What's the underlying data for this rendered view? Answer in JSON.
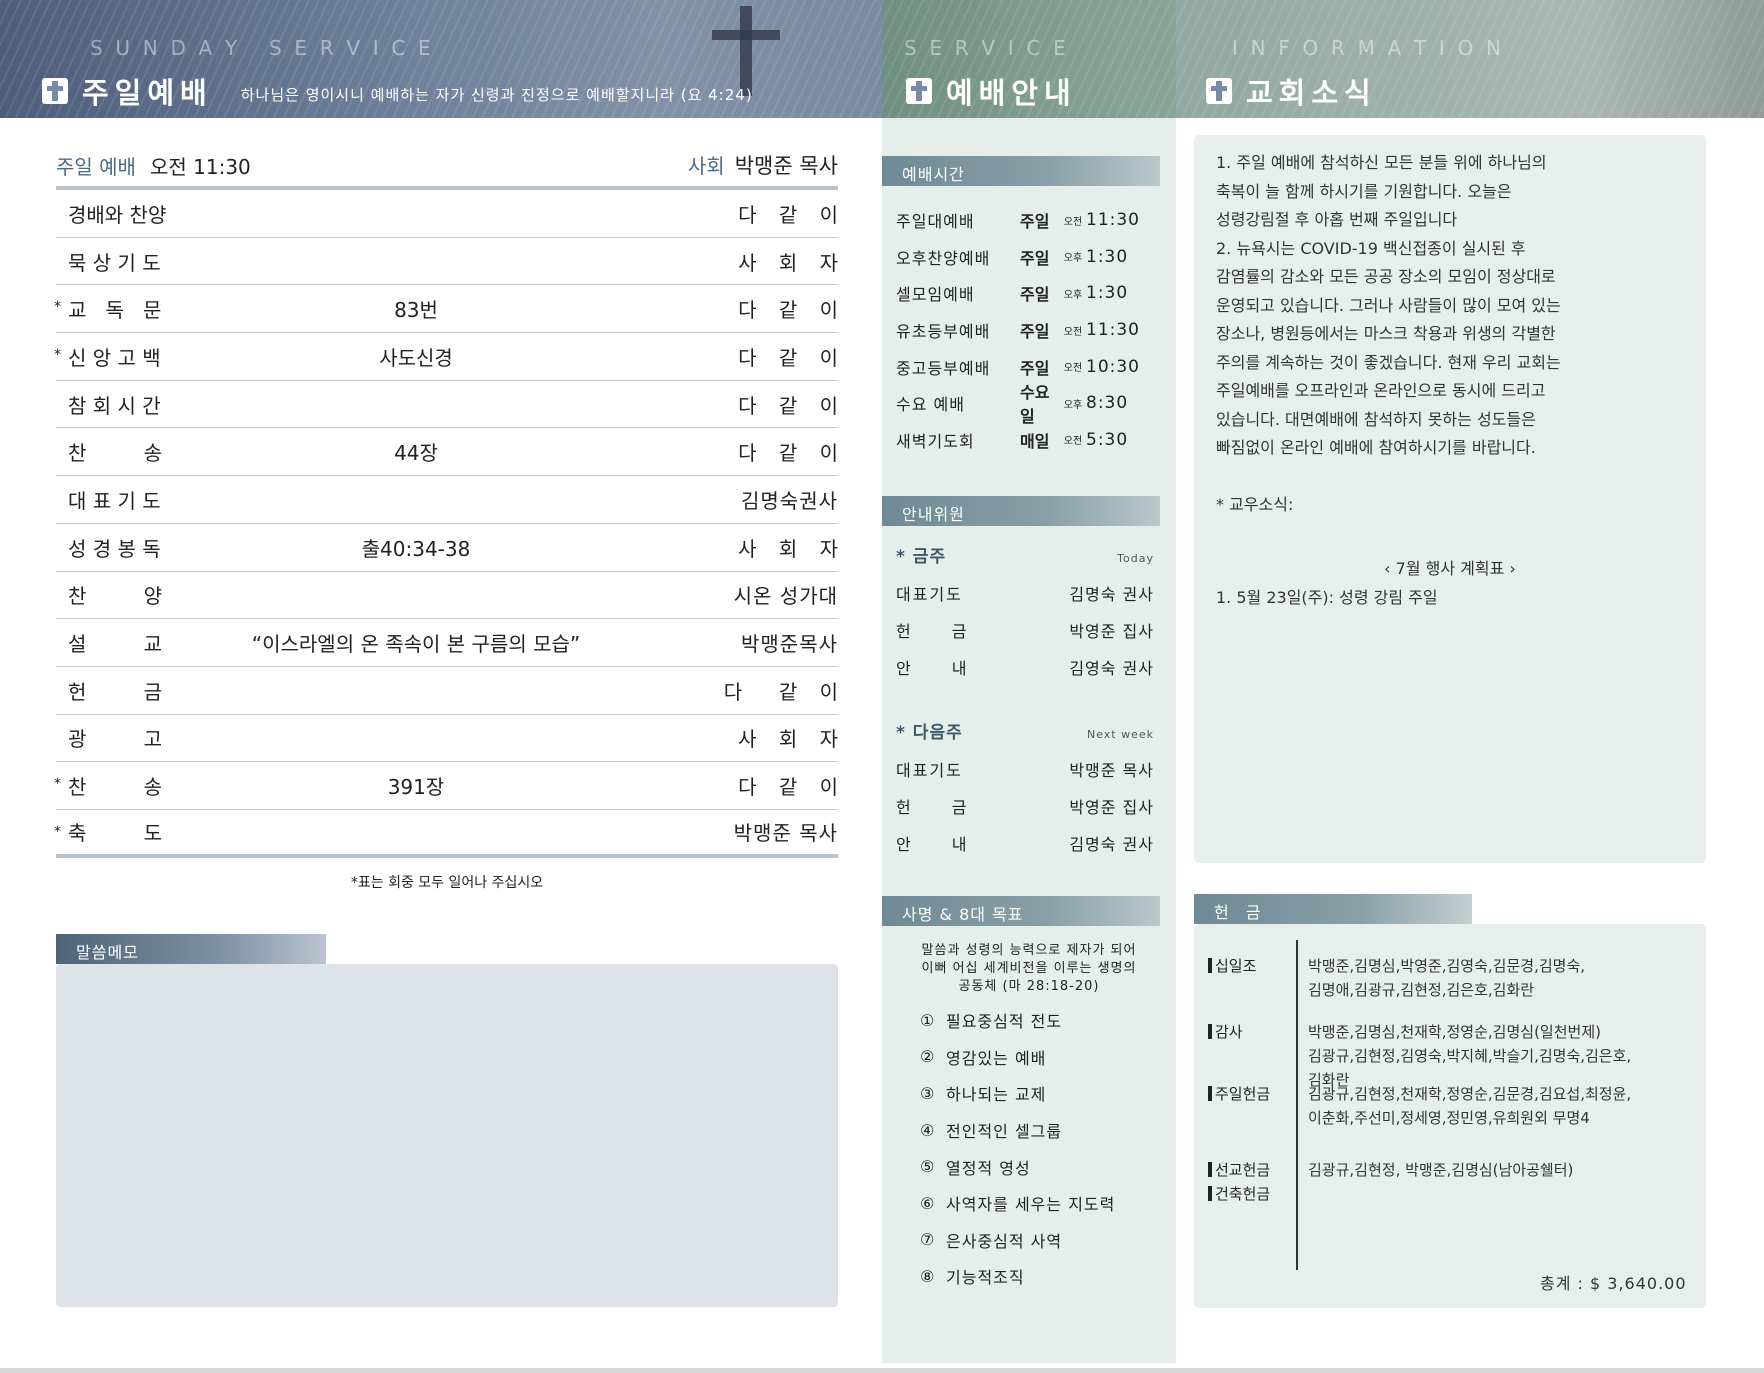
{
  "header": {
    "left": {
      "spaced": "S  U  N  D  A  Y     S  E  R  V  I  C  E",
      "title": "주일예배",
      "verse": "하나님은 영이시니 예배하는 자가 신령과 진정으로 예배할지니라 (요 4:24)"
    },
    "middle": {
      "spaced": "S  E  R  V  I  C  E",
      "title": "예배안내"
    },
    "right": {
      "spaced": "I  N  F  O  R  M  A  T  I  O  N",
      "title": "교회소식"
    },
    "icon": "cross-icon"
  },
  "service": {
    "label": "주일 예배",
    "time": "오전 11:30",
    "leader_label": "사회",
    "leader": "박맹준 목사",
    "order": [
      {
        "star": "",
        "item": "경배와 찬양",
        "center": "",
        "right": "다 같 이"
      },
      {
        "star": "",
        "item": "묵 상 기 도",
        "center": "",
        "right": "사 회 자"
      },
      {
        "star": "*",
        "item": "교   독   문",
        "center": "83번",
        "right": "다 같 이"
      },
      {
        "star": "*",
        "item": "신 앙 고 백",
        "center": "사도신경",
        "right": "다 같 이"
      },
      {
        "star": "",
        "item": "참 회 시 간",
        "center": "",
        "right": "다 같 이"
      },
      {
        "star": "",
        "item": "찬         송",
        "center": "44장",
        "right": "다 같 이"
      },
      {
        "star": "",
        "item": "대 표 기 도",
        "center": "",
        "right": "김명숙권사"
      },
      {
        "star": "",
        "item": "성 경 봉 독",
        "center": "출40:34-38",
        "right": "사 회 자"
      },
      {
        "star": "",
        "item": "찬         양",
        "center": "",
        "right": "시온 성가대"
      },
      {
        "star": "",
        "item": "설         교",
        "center": "“이스라엘의 온 족속이 본 구름의 모습”",
        "right": "박맹준목사"
      },
      {
        "star": "",
        "item": "헌         금",
        "center": "",
        "right": "다  같 이"
      },
      {
        "star": "",
        "item": "광         고",
        "center": "",
        "right": "사 회 자"
      },
      {
        "star": "*",
        "item": "찬         송",
        "center": "391장",
        "right": "다 같 이"
      },
      {
        "star": "*",
        "item": "축         도",
        "center": "",
        "right": "박맹준 목사"
      }
    ],
    "footnote": "*표는 회중 모두 일어나 주십시오",
    "memo_label": "말씀메모"
  },
  "guide": {
    "times_label": "예배시간",
    "times": [
      {
        "name": "주일대예배",
        "day": "주일",
        "ampm": "오전",
        "time": "11:30"
      },
      {
        "name": "오후찬양예배",
        "day": "주일",
        "ampm": "오후",
        "time": "1:30"
      },
      {
        "name": "셀모임예배",
        "day": "주일",
        "ampm": "오후",
        "time": "1:30"
      },
      {
        "name": "유초등부예배",
        "day": "주일",
        "ampm": "오전",
        "time": "11:30"
      },
      {
        "name": "중고등부예배",
        "day": "주일",
        "ampm": "오전",
        "time": "10:30"
      },
      {
        "name": "수요 예배",
        "day": "수요일",
        "ampm": "오후",
        "time": "8:30"
      },
      {
        "name": "새벽기도회",
        "day": "매일",
        "ampm": "오전",
        "time": "5:30"
      }
    ],
    "ushers_label": "안내위원",
    "this_week": {
      "title": "* 금주",
      "sub": "Today",
      "rows": [
        {
          "k": "대표기도",
          "v": "김명숙 권사"
        },
        {
          "k": "헌 금",
          "v": "박영준 집사"
        },
        {
          "k": "안 내",
          "v": "김영숙 권사"
        }
      ]
    },
    "next_week": {
      "title": "* 다음주",
      "sub": "Next week",
      "rows": [
        {
          "k": "대표기도",
          "v": "박맹준 목사"
        },
        {
          "k": "헌 금",
          "v": "박영준 집사"
        },
        {
          "k": "안 내",
          "v": "김명숙 권사"
        }
      ]
    },
    "mission_label": "사명 & 8대 목표",
    "mission": "말씀과 성령의 능력으로 제자가 되어\n이뻐 어십 세계비전을 이루는 생명의\n공동체 (마 28:18-20)",
    "goals": [
      {
        "no": "①",
        "text": "필요중심적 전도"
      },
      {
        "no": "②",
        "text": "영감있는 예배"
      },
      {
        "no": "③",
        "text": "하나되는 교제"
      },
      {
        "no": "④",
        "text": "전인적인 셀그룹"
      },
      {
        "no": "⑤",
        "text": "열정적 영성"
      },
      {
        "no": "⑥",
        "text": "사역자를 세우는 지도력"
      },
      {
        "no": "⑦",
        "text": "은사중심적 사역"
      },
      {
        "no": "⑧",
        "text": "기능적조직"
      }
    ]
  },
  "news": {
    "p1": "1. 주일 예배에 참석하신 모든 분들 위에 하나님의\n축복이 늘 함께 하시기를 기원합니다. 오늘은\n성령강림절 후 아홉 번째 주일입니다",
    "p2": "2. 뉴욕시는 COVID-19 백신접종이 실시된 후\n감염률의 감소와 모든 공공 장소의 모임이 정상대로\n운영되고 있습니다. 그러나 사람들이 많이 모여 있는\n장소나, 병원등에서는 마스크 착용과 위생의 각별한\n주의를 계속하는 것이 좋겠습니다. 현재 우리 교회는\n주일예배를 오프라인과 온라인으로 동시에 드리고\n있습니다. 대면예배에 참석하지 못하는 성도들은\n빠짐없이 온라인 예배에 참여하시기를 바랍니다.",
    "fellowship": "* 교우소식:",
    "plan": "‹  7월 행사 계획표  ›",
    "plan_item": "1. 5월 23일(주): 성령 강림 주일"
  },
  "offering": {
    "label": "헌 금",
    "groups": [
      {
        "labels": [
          "십일조"
        ],
        "names": "박맹준,김명심,박영준,김영숙,김문경,김명숙,\n김명애,김광규,김현정,김은호,김화란"
      },
      {
        "labels": [
          "감사"
        ],
        "names": "박맹준,김명심,천재학,정영순,김명심(일천번제)\n김광규,김현정,김영숙,박지혜,박슬기,김명숙,김은호,\n김화란"
      },
      {
        "labels": [
          "주일헌금"
        ],
        "names": "김광규,김현정,천재학,정영순,김문경,김요섭,최정윤,\n이춘화,주선미,정세영,정민영,유희원외  무명4"
      },
      {
        "labels": [
          "선교헌금",
          "건축헌금"
        ],
        "names": "김광규,김현정,  박맹준,김명심(남아공쉘터)"
      }
    ],
    "total": "총계 :  $  3,640.00"
  }
}
